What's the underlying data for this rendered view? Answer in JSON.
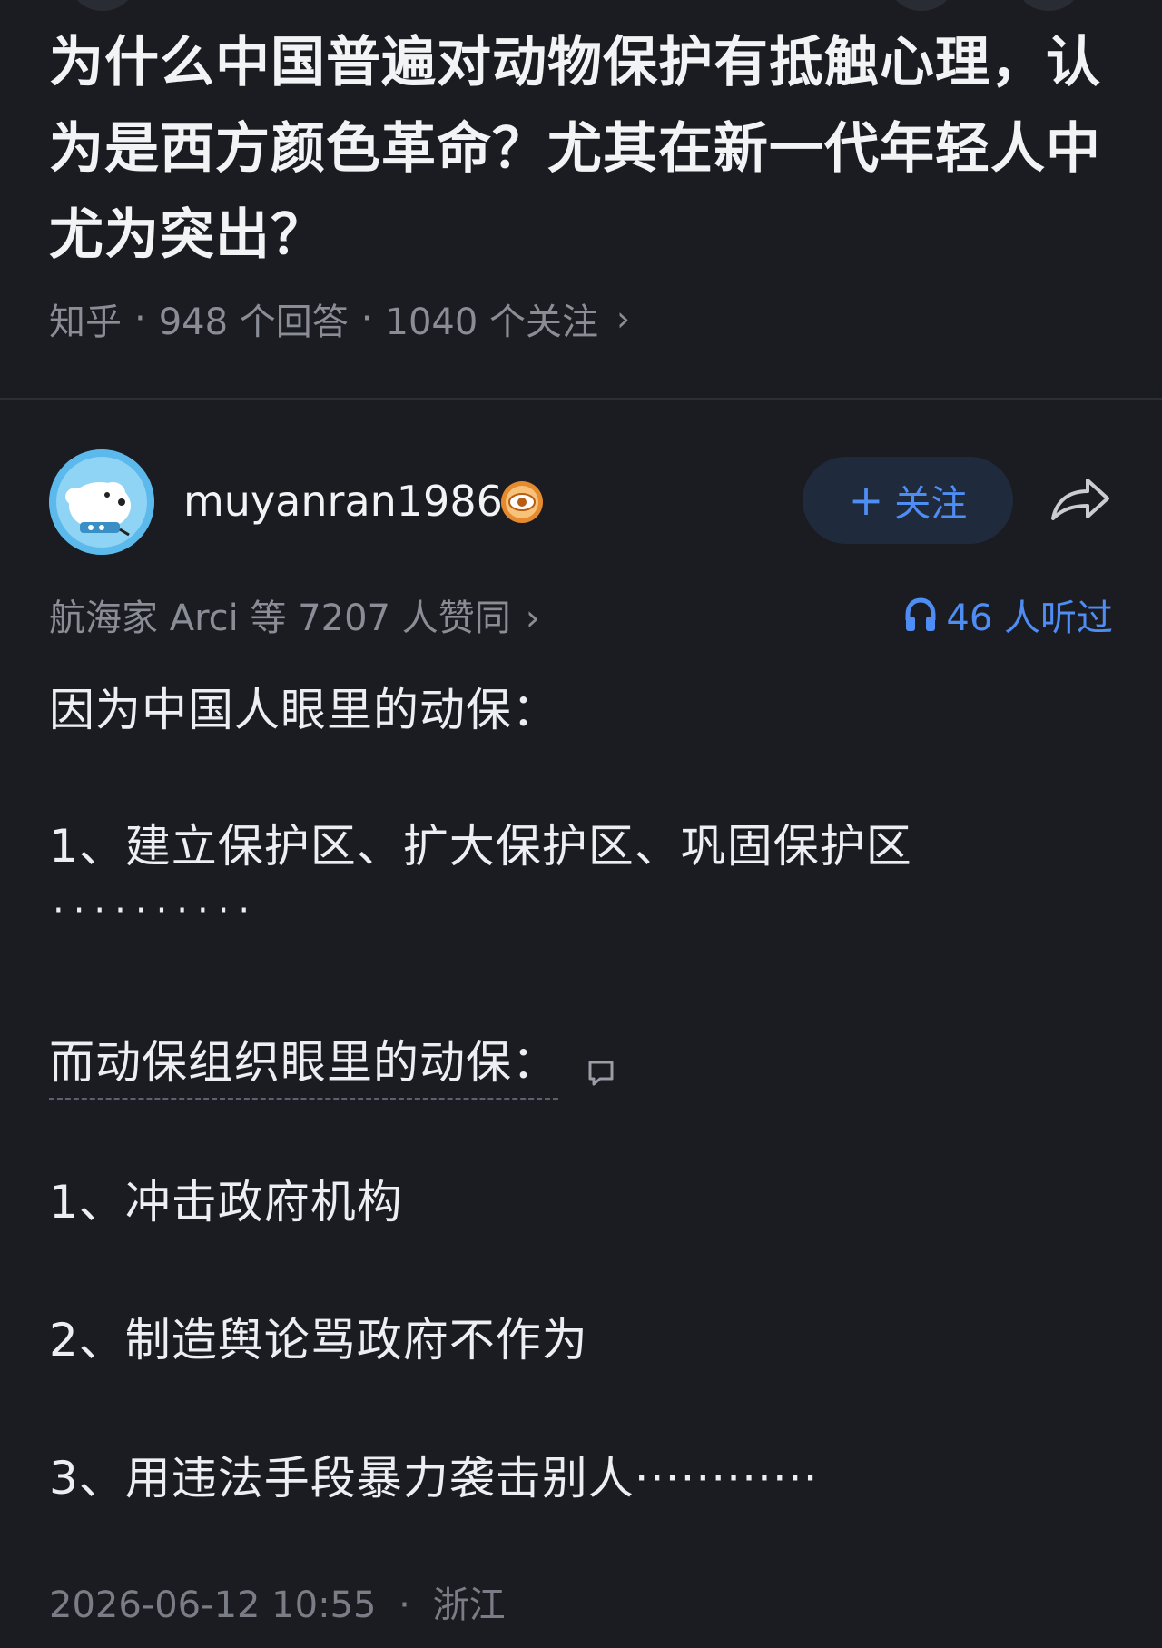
{
  "question": {
    "title": "为什么中国普遍对动物保护有抵触心理，认为是西方颜色革命？尤其在新一代年轻人中尤为突出？",
    "source": "知乎",
    "answer_count": "948 个回答",
    "follower_count": "1040 个关注",
    "chevron": "›"
  },
  "answer": {
    "author": {
      "name": "muyanran1986",
      "avatar_icon": "cartoon-dog-avatar",
      "badge_icon": "eye-badge-icon",
      "follow_label": "关注",
      "follow_plus": "+"
    },
    "share_icon": "share-arrow-icon",
    "endorsement": "航海家 Arci 等 7207 人赞同",
    "endorsement_chevron": "›",
    "listen_count": "46 人听过",
    "listen_icon": "headphones-icon",
    "paragraphs": {
      "intro": "因为中国人眼里的动保：",
      "china_1": "1、建立保护区、扩大保护区、巩固保护区",
      "china_dots": "··········",
      "org_intro": "而动保组织眼里的动保：",
      "org_1": "1、冲击政府机构",
      "org_2": "2、制造舆论骂政府不作为",
      "org_3": "3、用违法手段暴力袭击别人············"
    },
    "comment_icon": "comment-bubble-icon",
    "date": "2026-06-12 10:55",
    "location": "浙江",
    "footer_sep": "·"
  },
  "colors": {
    "background": "#1b1c21",
    "accent": "#4e8df3",
    "text_primary": "#eceef2",
    "text_secondary": "#8a8d96",
    "follow_button_bg": "#1f2a3c"
  }
}
